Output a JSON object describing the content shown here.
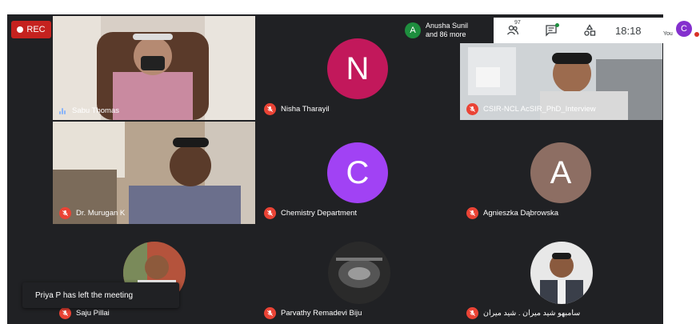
{
  "recording": {
    "label": "REC"
  },
  "notification_pill": {
    "avatar_letter": "A",
    "line1": "Anusha Sunil",
    "line2": "and 86 more"
  },
  "toolbar": {
    "people_count": "97",
    "people_icon": "people-icon",
    "chat_icon": "chat-icon",
    "activities_icon": "activities-icon",
    "time": "18:18"
  },
  "self": {
    "label": "You",
    "avatar_letter": "C",
    "avatar_color": "#8430ce"
  },
  "participants": [
    {
      "name": "Sabu Thomas",
      "type": "video",
      "speaking": true,
      "muted": false
    },
    {
      "name": "Nisha Tharayil",
      "type": "avatar",
      "letter": "N",
      "color": "#c2185b",
      "muted": true
    },
    {
      "name": "CSIR-NCL AcSIR_PhD_Interview",
      "type": "video",
      "muted": true
    },
    {
      "name": "Dr. Murugan K",
      "type": "video",
      "muted": true
    },
    {
      "name": "Chemistry Department",
      "type": "avatar",
      "letter": "C",
      "color": "#a142f4",
      "muted": true
    },
    {
      "name": "Agnieszka Dąbrowska",
      "type": "avatar",
      "letter": "A",
      "color": "#8d6e63",
      "muted": true
    },
    {
      "name": "Saju Pillai",
      "type": "photo",
      "muted": true
    },
    {
      "name": "Parvathy Remadevi Biju",
      "type": "photo",
      "muted": true
    },
    {
      "name": "سامبهو شيد ميران . شيد ميران",
      "type": "photo",
      "muted": true
    }
  ],
  "toast": {
    "text": "Priya P has left the meeting"
  },
  "colors": {
    "background": "#202124",
    "tile": "#3c4043",
    "muted_badge": "#ea4335",
    "rec": "#c5221f"
  }
}
